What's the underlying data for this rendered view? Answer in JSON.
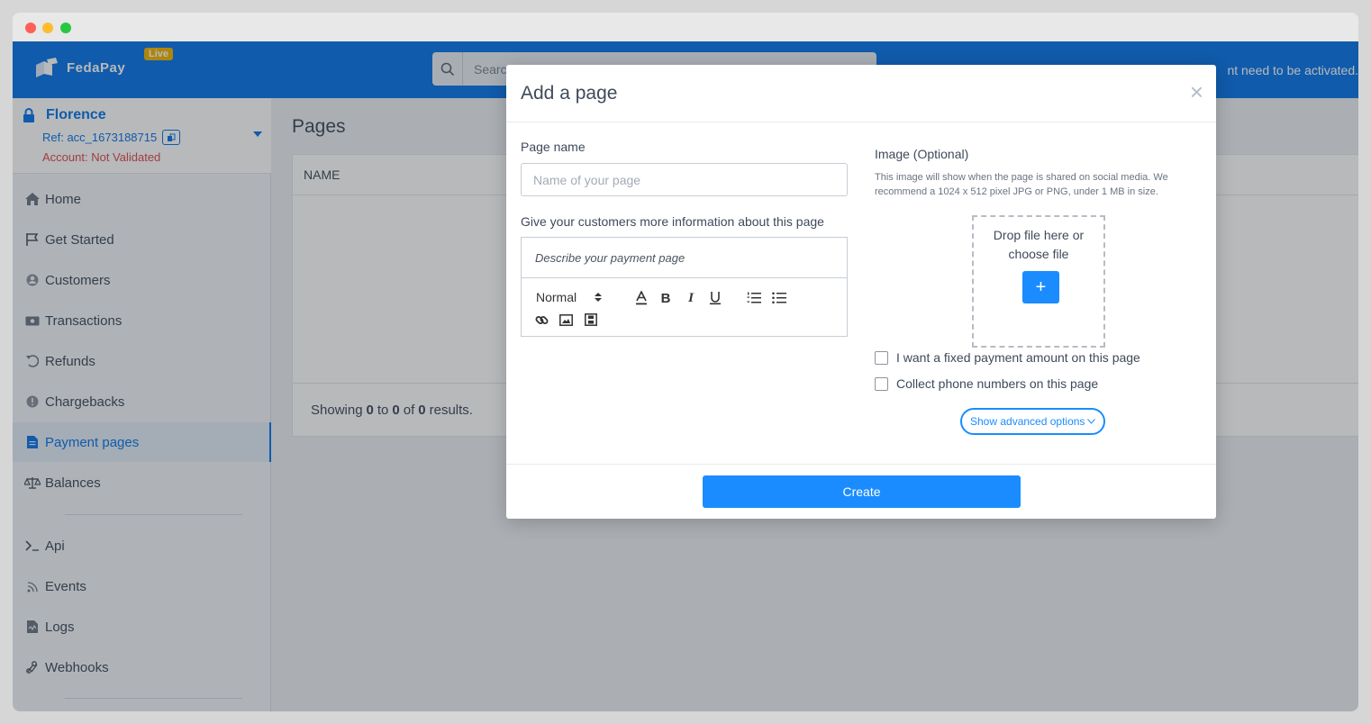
{
  "brand": {
    "name": "FedaPay",
    "badge": "Live"
  },
  "search": {
    "placeholder": "Searc"
  },
  "topbar": {
    "notice": "nt need to be activated."
  },
  "account": {
    "name": "Florence",
    "ref": "Ref: acc_1673188715",
    "status": "Account: Not Validated"
  },
  "sidebar": {
    "items": [
      {
        "label": "Home",
        "icon": "home-icon"
      },
      {
        "label": "Get Started",
        "icon": "flag-icon"
      },
      {
        "label": "Customers",
        "icon": "user-circle-icon"
      },
      {
        "label": "Transactions",
        "icon": "money-icon"
      },
      {
        "label": "Refunds",
        "icon": "undo-icon"
      },
      {
        "label": "Chargebacks",
        "icon": "alert-icon"
      },
      {
        "label": "Payment pages",
        "icon": "document-icon"
      },
      {
        "label": "Balances",
        "icon": "scale-icon"
      },
      {
        "label": "Api",
        "icon": "terminal-icon"
      },
      {
        "label": "Events",
        "icon": "rss-icon"
      },
      {
        "label": "Logs",
        "icon": "log-icon"
      },
      {
        "label": "Webhooks",
        "icon": "webhook-icon"
      }
    ],
    "active": "Payment pages"
  },
  "content": {
    "title": "Pages",
    "table": {
      "columns": [
        "NAME"
      ],
      "footer": {
        "prefix": "Showing",
        "from": "0",
        "to_word": "to",
        "to": "0",
        "of_word": "of",
        "total": "0",
        "suffix": "results."
      }
    }
  },
  "modal": {
    "title": "Add a page",
    "close": "×",
    "page_name_label": "Page name",
    "page_name_placeholder": "Name of your page",
    "description_label": "Give your customers more information about this page",
    "description_placeholder": "Describe your payment page",
    "toolbar": {
      "format": "Normal"
    },
    "image_label": "Image (Optional)",
    "image_description": "This image will show when the page is shared on social media. We recommend a 1024 x 512 pixel JPG or PNG, under 1 MB in size.",
    "dropzone_text": "Drop file here or choose file",
    "dropzone_button": "+",
    "fixed_amount_label": "I want a fixed payment amount on this page",
    "collect_phone_label": "Collect phone numbers on this page",
    "advanced_options": "Show advanced options",
    "create_button": "Create"
  },
  "colors": {
    "primary": "#0a75e8",
    "button": "#1a8cff",
    "badge": "#f0b400",
    "error": "#e04a4a"
  }
}
